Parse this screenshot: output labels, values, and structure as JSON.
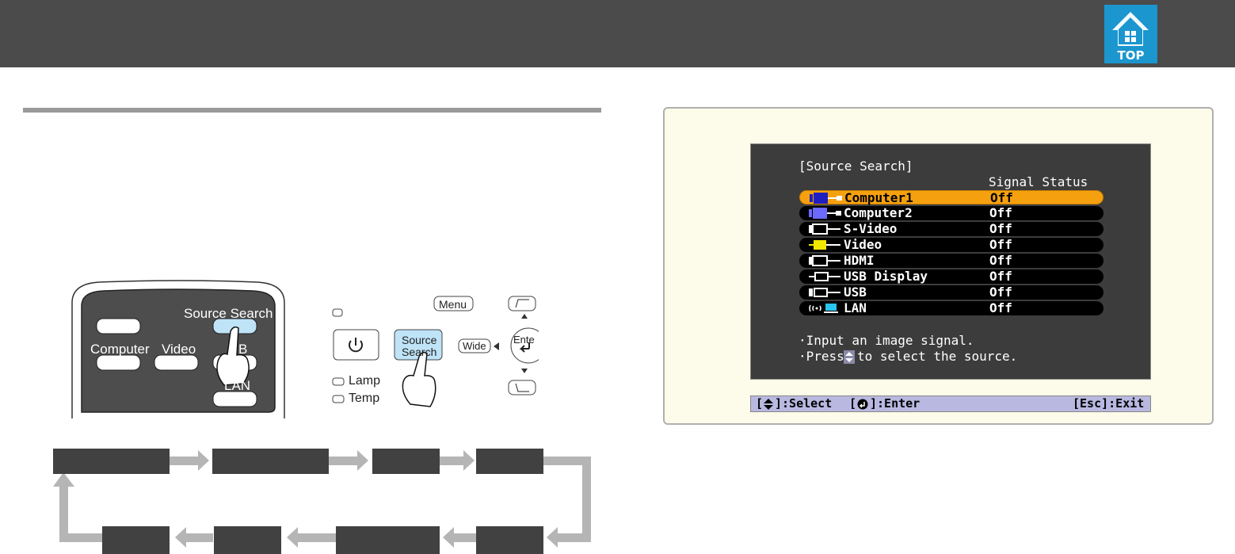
{
  "header": {
    "top_label": "TOP"
  },
  "remote": {
    "source_search": "Source Search",
    "computer": "Computer",
    "video": "Video",
    "usb_partial": "B",
    "lan": "LAN"
  },
  "panel": {
    "menu": "Menu",
    "source_line1": "Source",
    "source_line2": "Search",
    "wide": "Wide",
    "enter": "Ente",
    "lamp": "Lamp",
    "temp": "Temp"
  },
  "osd": {
    "title": "[Source Search]",
    "signal_status_header": "Signal Status",
    "rows": [
      {
        "name": "Computer1",
        "status": "Off",
        "selected": true,
        "icon": "computer1-icon"
      },
      {
        "name": "Computer2",
        "status": "Off",
        "selected": false,
        "icon": "computer2-icon"
      },
      {
        "name": "S-Video",
        "status": "Off",
        "selected": false,
        "icon": "s-video-icon"
      },
      {
        "name": "Video",
        "status": "Off",
        "selected": false,
        "icon": "video-icon"
      },
      {
        "name": "HDMI",
        "status": "Off",
        "selected": false,
        "icon": "hdmi-icon"
      },
      {
        "name": "USB Display",
        "status": "Off",
        "selected": false,
        "icon": "usb-display-icon"
      },
      {
        "name": "USB",
        "status": "Off",
        "selected": false,
        "icon": "usb-icon"
      },
      {
        "name": "LAN",
        "status": "Off",
        "selected": false,
        "icon": "lan-icon"
      }
    ],
    "message1": "·Input an image signal.",
    "message2_pre": "·Press",
    "message2_post": "to select the source."
  },
  "bottom_bar": {
    "select": "[",
    "select_after": "]:Select",
    "enter": "[",
    "enter_after": "]:Enter",
    "exit": "[Esc]:Exit"
  },
  "colors": {
    "header_bg": "#4b4b4b",
    "top_button": "#1b96cf",
    "selected_row": "#f5a10f",
    "screen_bg": "#fdfbe9",
    "flow_box": "#414141",
    "flow_arrow": "#b5b5b5"
  }
}
